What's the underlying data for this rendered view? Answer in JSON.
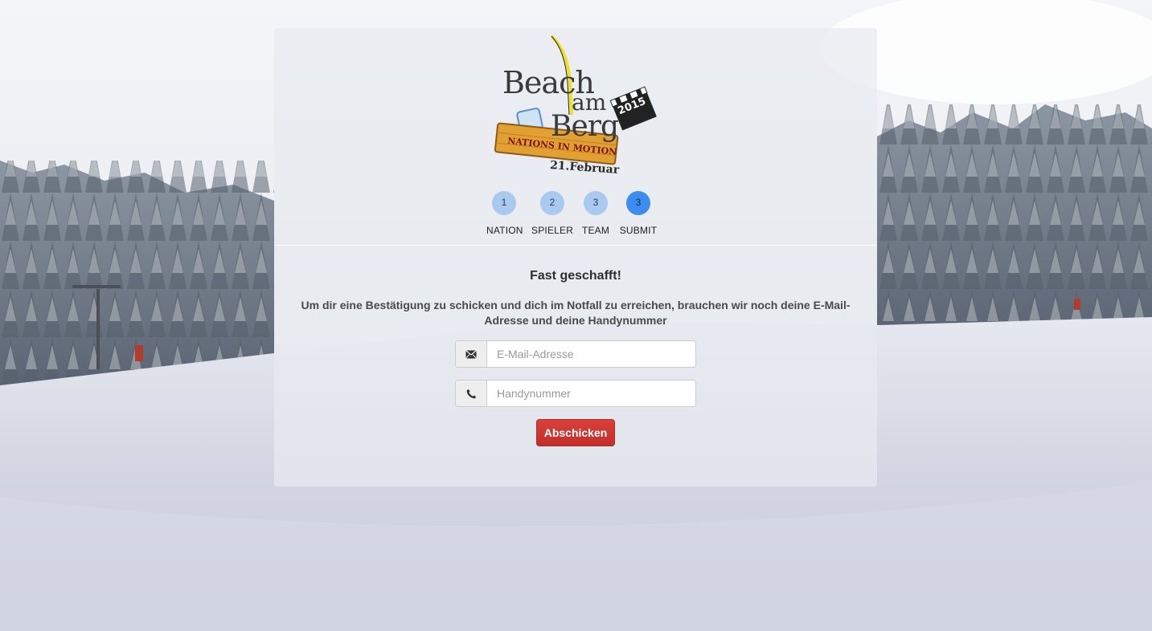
{
  "logo": {
    "line1": "Beach",
    "line2": "am",
    "line3": "Berg",
    "year": "2015",
    "banner": "NATIONS IN MOTION",
    "date": "21.Februar"
  },
  "steps": [
    {
      "number": "1",
      "label": "NATION",
      "active": false
    },
    {
      "number": "2",
      "label": "SPIELER",
      "active": false
    },
    {
      "number": "3",
      "label": "TEAM",
      "active": false
    },
    {
      "number": "3",
      "label": "SUBMIT",
      "active": true
    }
  ],
  "form": {
    "title": "Fast geschafft!",
    "description": "Um dir eine Bestätigung zu schicken und dich im Notfall zu erreichen, brauchen wir noch deine E-Mail-Adresse und deine Handynummer",
    "email": {
      "placeholder": "E-Mail-Adresse",
      "value": "",
      "icon": "envelope-icon"
    },
    "phone": {
      "placeholder": "Handynummer",
      "value": "",
      "icon": "phone-icon"
    },
    "submit_label": "Abschicken"
  },
  "colors": {
    "step_inactive": "#a9c9ee",
    "step_active": "#3d8df0",
    "submit": "#c9302c"
  }
}
